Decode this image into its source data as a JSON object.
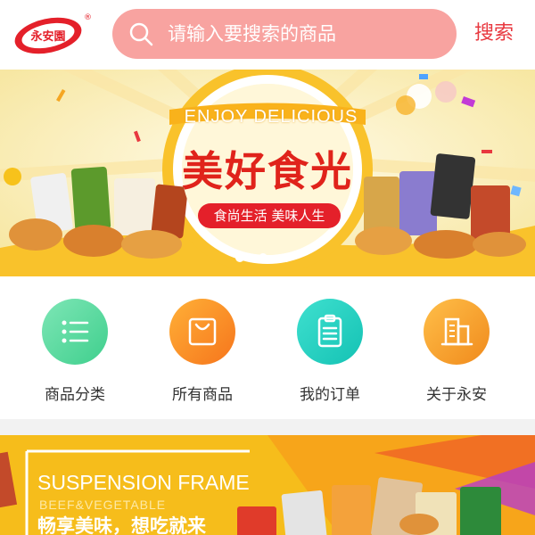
{
  "header": {
    "logo_text": "永安園",
    "logo_mark": "®",
    "search_placeholder": "请输入要搜索的商品",
    "search_button": "搜索"
  },
  "banner": {
    "headline_en": "ENJOY DELICIOUS",
    "headline_cn": "美好食光",
    "tagline": "食尚生活 美味人生",
    "slide_count": 3,
    "active_slide": 1
  },
  "nav": [
    {
      "label": "商品分类",
      "icon": "list-icon",
      "color": "#4ed69a"
    },
    {
      "label": "所有商品",
      "icon": "shopping-bag-icon",
      "color": "#f98b1e"
    },
    {
      "label": "我的订单",
      "icon": "clipboard-icon",
      "color": "#17cfb8"
    },
    {
      "label": "关于永安",
      "icon": "building-icon",
      "color": "#f39a26"
    }
  ],
  "promo": {
    "title_en": "SUSPENSION FRAME",
    "subtitle_en": "BEEF&VEGETABLE",
    "title_cn": "畅享美味，想吃就来"
  },
  "colors": {
    "brand_red": "#e8383f",
    "search_bg": "#f8a3a0",
    "banner_yellow": "#f9c22b",
    "promo_yellow": "#f6bd1b"
  }
}
